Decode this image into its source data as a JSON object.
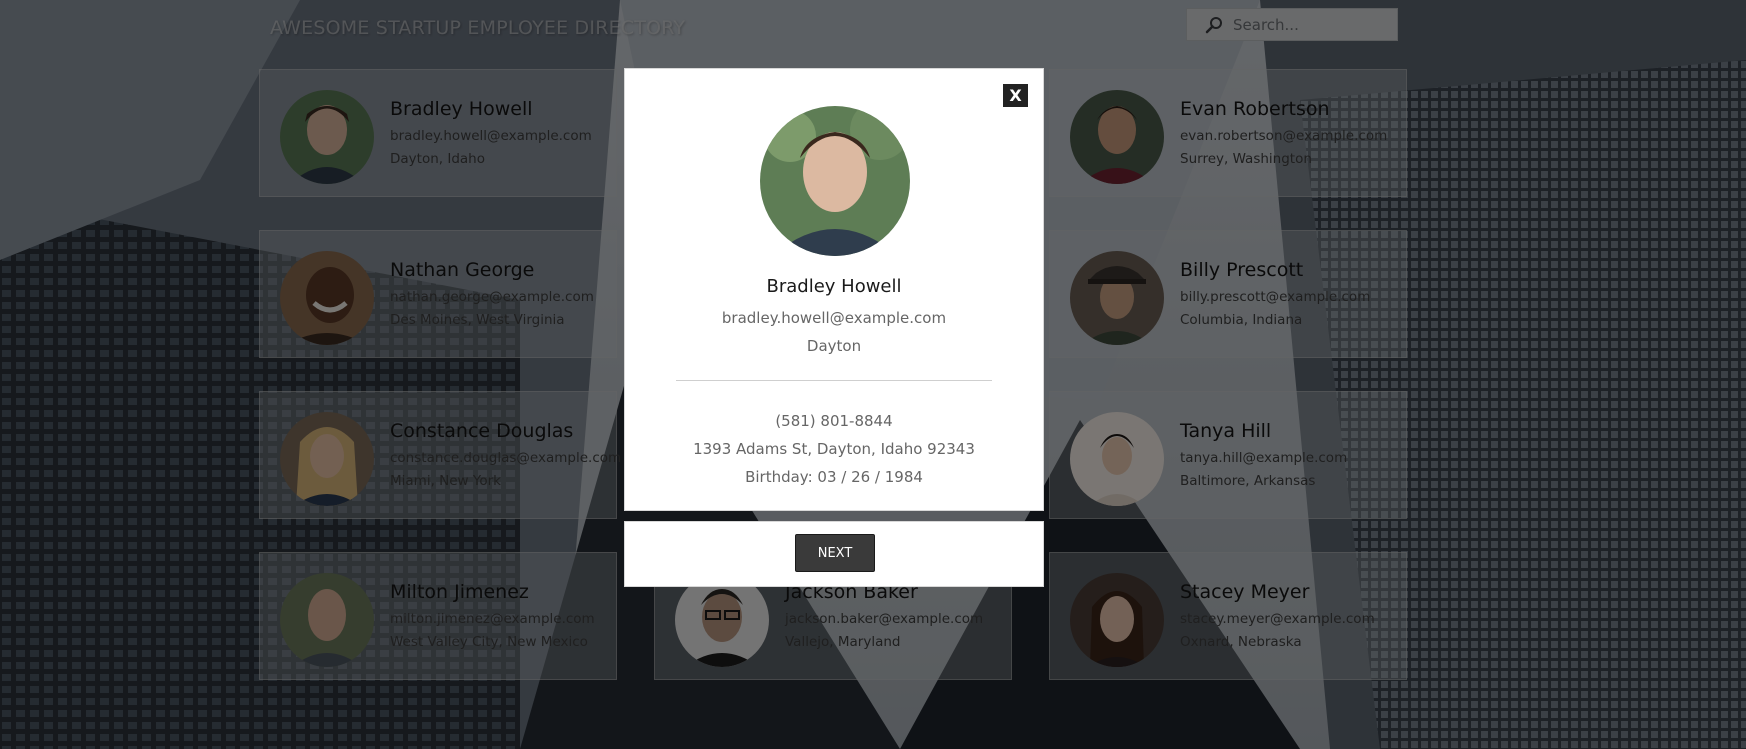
{
  "header": {
    "title": "AWESOME STARTUP EMPLOYEE DIRECTORY",
    "search_placeholder": "Search..."
  },
  "employees": [
    {
      "name": "Bradley Howell",
      "email": "bradley.howell@example.com",
      "location": "Dayton, Idaho"
    },
    {
      "name": "Evan Robertson",
      "email": "evan.robertson@example.com",
      "location": "Surrey, Washington"
    },
    {
      "name": "Nathan George",
      "email": "nathan.george@example.com",
      "location": "Des Moines, West Virginia"
    },
    {
      "name": "Billy Prescott",
      "email": "billy.prescott@example.com",
      "location": "Columbia, Indiana"
    },
    {
      "name": "Constance Douglas",
      "email": "constance.douglas@example.com",
      "location": "Miami, New York"
    },
    {
      "name": "Tanya Hill",
      "email": "tanya.hill@example.com",
      "location": "Baltimore, Arkansas"
    },
    {
      "name": "Milton Jimenez",
      "email": "milton.jimenez@example.com",
      "location": "West Valley City, New Mexico"
    },
    {
      "name": "Jackson Baker",
      "email": "jackson.baker@example.com",
      "location": "Vallejo, Maryland"
    },
    {
      "name": "Stacey Meyer",
      "email": "stacey.meyer@example.com",
      "location": "Oxnard, Nebraska"
    }
  ],
  "modal": {
    "close_label": "X",
    "name": "Bradley Howell",
    "email": "bradley.howell@example.com",
    "city": "Dayton",
    "phone": "(581) 801-8844",
    "address": "1393 Adams St, Dayton, Idaho 92343",
    "birthday": "Birthday: 03 / 26 / 1984",
    "next_label": "NEXT"
  },
  "icons": {
    "search": "search-icon",
    "close": "close-icon"
  }
}
